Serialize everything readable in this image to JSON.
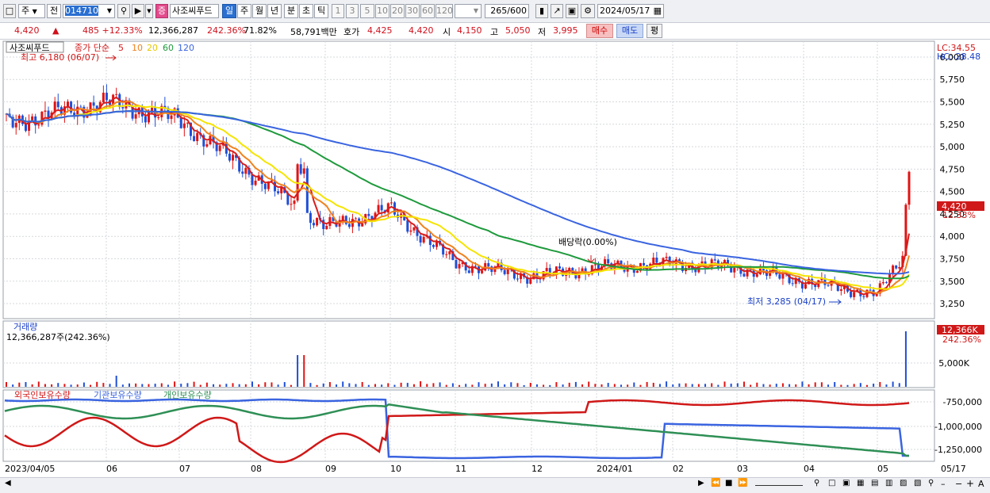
{
  "toolbar": {
    "market": "주",
    "prev": "전",
    "code": "014710",
    "name": "사조씨푸드",
    "periods": [
      "일",
      "주",
      "월",
      "년",
      "분",
      "초",
      "틱"
    ],
    "active_period": "일",
    "counts": [
      "1",
      "3",
      "5",
      "10",
      "20",
      "30",
      "60",
      "120"
    ],
    "view": "265",
    "view_total": "/600",
    "date": "2024/05/17"
  },
  "quote": {
    "price": "4,420",
    "change": "485 +12.33%",
    "volume": "12,366,287",
    "vol_ratio": "242.36%",
    "turnover": "71.82%",
    "amount": "58,791백만",
    "bid_label": "호가",
    "ask": "4,425",
    "bid": "4,420",
    "open_label": "시",
    "open": "4,150",
    "high_label": "고",
    "high": "5,050",
    "low_label": "저",
    "low": "3,995",
    "buy": "매수",
    "sell": "매도",
    "eval": "평"
  },
  "chart_data": [
    {
      "type": "line",
      "title": "사조씨푸드",
      "legend": [
        "종가 단순",
        "5",
        "10",
        "20",
        "60",
        "120"
      ],
      "x": [
        "2023/04/05",
        "06",
        "07",
        "08",
        "09",
        "10",
        "11",
        "12",
        "2024/01",
        "02",
        "03",
        "04",
        "05",
        "05/17"
      ],
      "close_approx": [
        5250,
        5500,
        5300,
        4700,
        4100,
        4300,
        3700,
        3550,
        3650,
        3700,
        3650,
        3500,
        3350,
        4420
      ],
      "ylim": [
        3100,
        6150
      ],
      "y_ticks": [
        "6,000",
        "5,750",
        "5,500",
        "5,250",
        "5,000",
        "4,750",
        "4,500",
        "4,250",
        "4,000",
        "3,750",
        "3,500",
        "3,250"
      ],
      "annotations": [
        "최고 6,180 (06/07)",
        "최저 3,285 (04/17)",
        "배당락(0.00%)"
      ],
      "lc": "LC:34.55",
      "hc": "HC:-28.48",
      "last_price": "4,420",
      "last_pct": "12.33%",
      "colors": {
        "ma5": "#d81c1c",
        "ma10": "#f0821e",
        "ma20": "#f5e400",
        "ma60": "#1e9a3c",
        "ma120": "#3a64e0"
      }
    },
    {
      "type": "bar",
      "title": "거래량",
      "info": "12,366,287주(242.36%)",
      "y_ticks": [
        "5,000K"
      ],
      "last_value": "12,366K",
      "last_pct": "242.36%"
    },
    {
      "type": "line",
      "legend": [
        "외국인보유수량",
        "기관보유수량",
        "개인보유수량"
      ],
      "y_ticks": [
        "-750,000",
        "-1,000,000",
        "-1,250,000"
      ],
      "colors": {
        "foreign": "#d01818",
        "institution": "#3a64e0",
        "individual": "#2e8f55"
      }
    }
  ]
}
